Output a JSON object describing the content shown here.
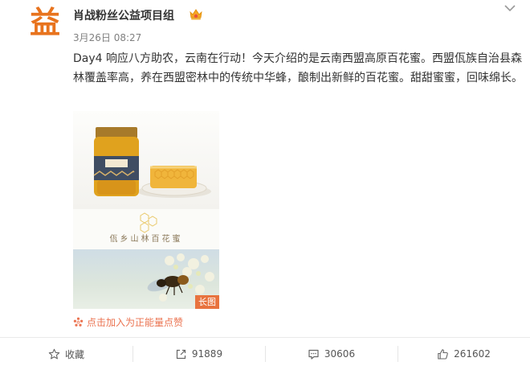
{
  "post": {
    "username": "肖战粉丝公益项目组",
    "avatar_glyph": "益",
    "timestamp": "3月26日 08:27",
    "text": "Day4 响应八方助农，云南在行动！今天介绍的是云南西盟高原百花蜜。西盟佤族自治县森林覆盖率高，养在西盟密林中的传统中华蜂，酿制出新鲜的百花蜜。甜甜蜜蜜，回味绵长。",
    "image_caption": "佤乡山林百花蜜",
    "image_badge": "长图",
    "energy_link": "点击加入为正能量点赞"
  },
  "actions": {
    "favorite_label": "收藏",
    "repost_count": "91889",
    "comment_count": "30606",
    "like_count": "261602"
  },
  "colors": {
    "accent_orange": "#eb7350",
    "avatar_orange": "#e8731d",
    "text": "#333333",
    "muted": "#808080"
  },
  "icons": [
    "vip-crown-icon",
    "chevron-down-icon",
    "star-icon",
    "repost-icon",
    "comment-icon",
    "thumbs-up-icon",
    "energy-flower-icon"
  ]
}
